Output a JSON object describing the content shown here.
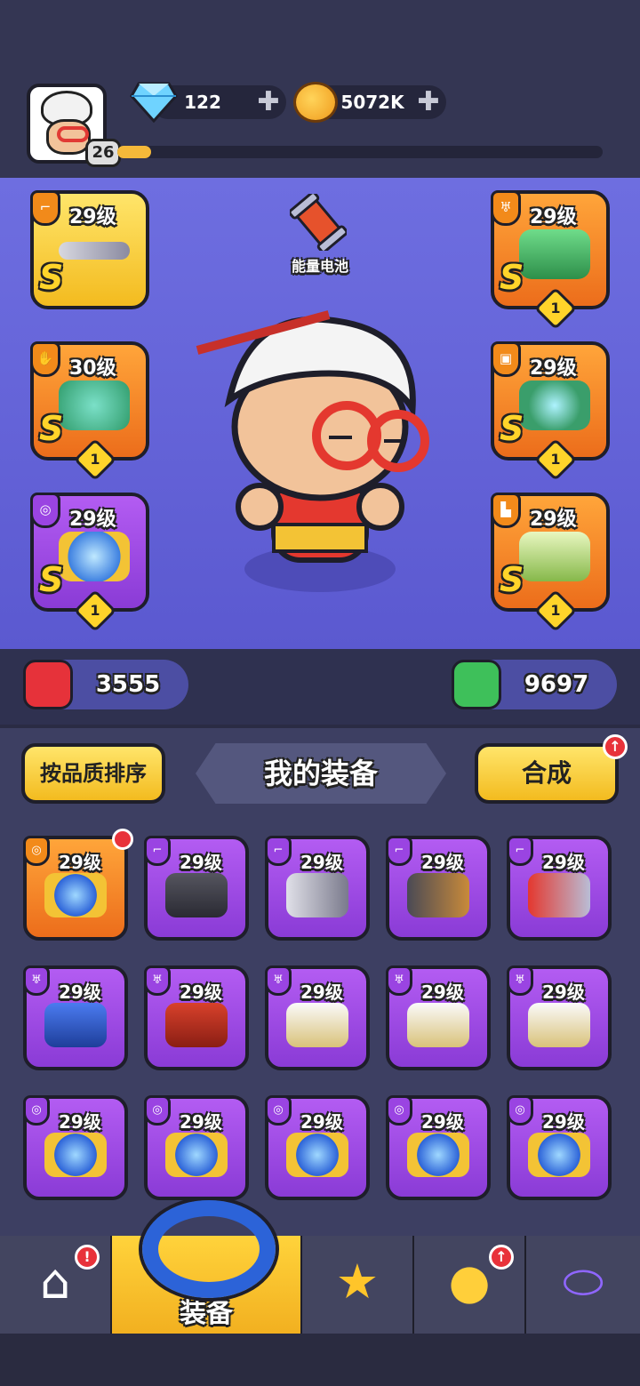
{
  "topbar": {
    "player_level": "26",
    "xp_progress": 0.07,
    "gems": "122",
    "coins": "5072K",
    "plus": "✚",
    "icons": {
      "gem": "diamond-icon",
      "coin": "coin-icon"
    }
  },
  "hero": {
    "consumable_label": "能量电池",
    "left_slots": [
      {
        "level": "29级",
        "grade": "S",
        "stars": "",
        "type": "weapon",
        "color": "gold"
      },
      {
        "level": "30级",
        "grade": "S",
        "stars": "1",
        "type": "glove",
        "color": "orange"
      },
      {
        "level": "29级",
        "grade": "S",
        "stars": "1",
        "type": "ring",
        "color": "purple"
      }
    ],
    "right_slots": [
      {
        "level": "29级",
        "grade": "S",
        "stars": "1",
        "type": "armor",
        "color": "orange"
      },
      {
        "level": "29级",
        "grade": "S",
        "stars": "1",
        "type": "belt",
        "color": "orange"
      },
      {
        "level": "29级",
        "grade": "S",
        "stars": "1",
        "type": "boots",
        "color": "orange"
      }
    ],
    "attack": "3555",
    "hp": "9697"
  },
  "panel": {
    "sort_button": "按品质排序",
    "title": "我的装备",
    "merge_button": "合成",
    "merge_alert": "↑",
    "items": [
      {
        "level": "29级",
        "type": "ring",
        "color": "orange",
        "alert": true
      },
      {
        "level": "29级",
        "type": "pistol",
        "color": "purple"
      },
      {
        "level": "29级",
        "type": "knife",
        "color": "purple"
      },
      {
        "level": "29级",
        "type": "shotgun",
        "color": "purple"
      },
      {
        "level": "29级",
        "type": "wand",
        "color": "purple"
      },
      {
        "level": "29级",
        "type": "cape",
        "color": "purple"
      },
      {
        "level": "29级",
        "type": "vest",
        "color": "purple"
      },
      {
        "level": "29级",
        "type": "coat",
        "color": "purple"
      },
      {
        "level": "29级",
        "type": "coat",
        "color": "purple"
      },
      {
        "level": "29级",
        "type": "coat",
        "color": "purple"
      },
      {
        "level": "29级",
        "type": "ring",
        "color": "purple"
      },
      {
        "level": "29级",
        "type": "ring",
        "color": "purple"
      },
      {
        "level": "29级",
        "type": "ring",
        "color": "purple"
      },
      {
        "level": "29级",
        "type": "ring",
        "color": "purple"
      },
      {
        "level": "29级",
        "type": "ring",
        "color": "purple"
      }
    ]
  },
  "nav": {
    "tabs": [
      {
        "label": "",
        "icon": "shop-house-icon",
        "alert": "!"
      },
      {
        "label": "装备",
        "icon": "ring-icon",
        "active": true
      },
      {
        "label": "",
        "icon": "star-weapons-icon"
      },
      {
        "label": "",
        "icon": "egg-pet-icon",
        "alert": "↑"
      },
      {
        "label": "",
        "icon": "capsule-icon"
      }
    ]
  }
}
